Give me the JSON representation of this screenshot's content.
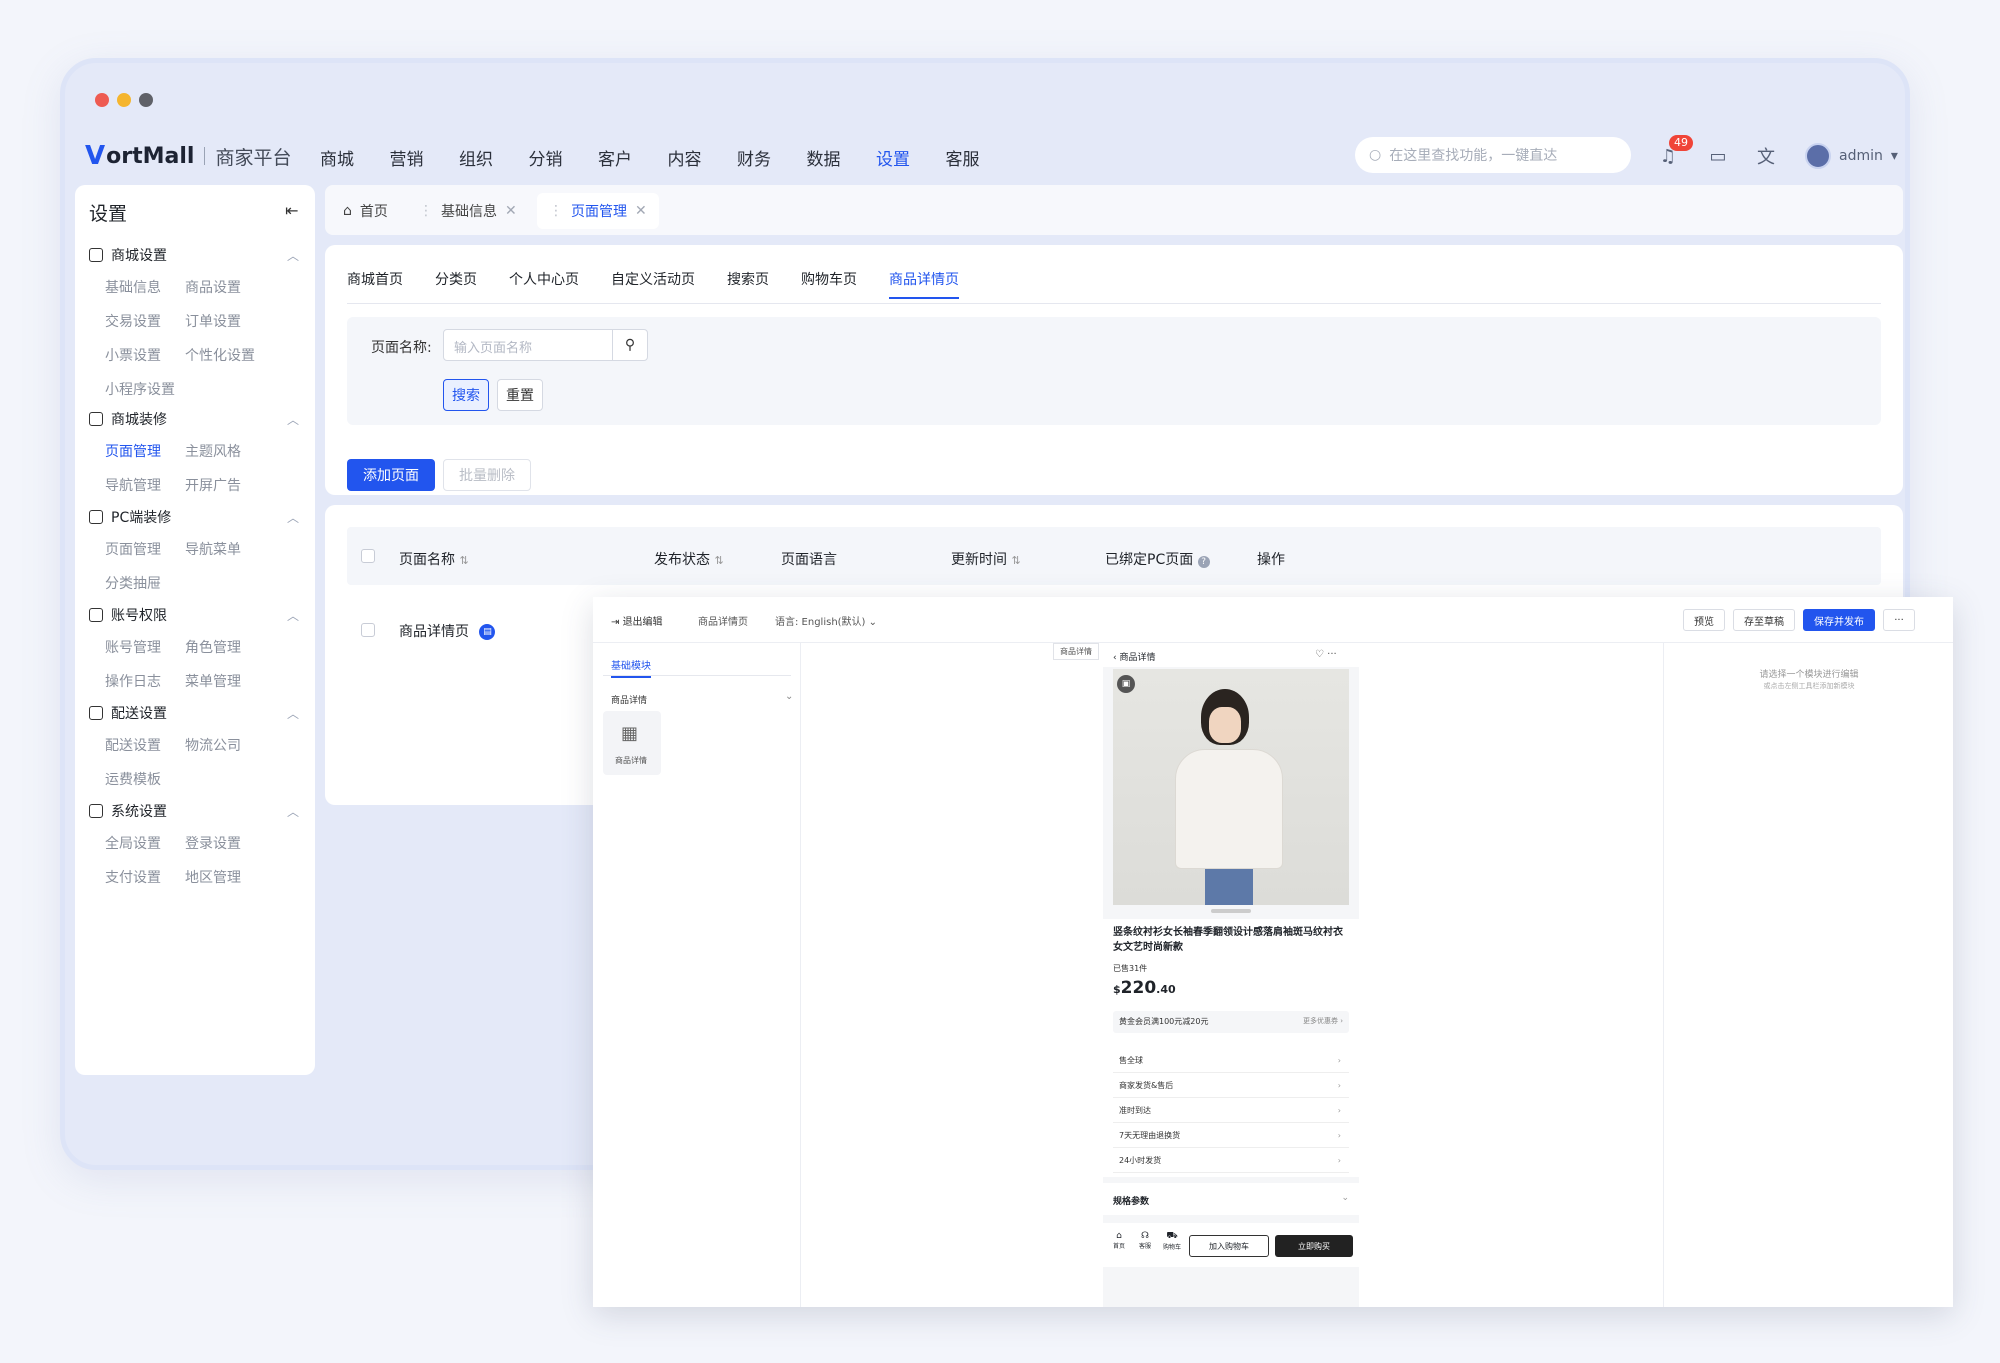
{
  "brand": {
    "logo_mark": "V",
    "logo_text": "ortMall",
    "subtitle": "商家平台"
  },
  "nav": [
    "商城",
    "营销",
    "组织",
    "分销",
    "客户",
    "内容",
    "财务",
    "数据",
    "设置",
    "客服"
  ],
  "nav_active": "设置",
  "search": {
    "placeholder": "在这里查找功能，一键直达"
  },
  "notifications": {
    "count": "49"
  },
  "user": {
    "name": "admin"
  },
  "sidebar": {
    "title": "设置",
    "groups": [
      {
        "label": "商城设置",
        "items": [
          "基础信息",
          "商品设置",
          "交易设置",
          "订单设置",
          "小票设置",
          "个性化设置",
          "小程序设置"
        ]
      },
      {
        "label": "商城装修",
        "items": [
          "页面管理",
          "主题风格",
          "导航管理",
          "开屏广告"
        ]
      },
      {
        "label": "PC端装修",
        "items": [
          "页面管理",
          "导航菜单",
          "分类抽屉"
        ]
      },
      {
        "label": "账号权限",
        "items": [
          "账号管理",
          "角色管理",
          "操作日志",
          "菜单管理"
        ]
      },
      {
        "label": "配送设置",
        "items": [
          "配送设置",
          "物流公司",
          "运费模板"
        ]
      },
      {
        "label": "系统设置",
        "items": [
          "全局设置",
          "登录设置",
          "支付设置",
          "地区管理"
        ]
      }
    ]
  },
  "page_tabs": [
    "首页",
    "基础信息",
    "页面管理"
  ],
  "content_tabs": [
    "商城首页",
    "分类页",
    "个人中心页",
    "自定义活动页",
    "搜索页",
    "购物车页",
    "商品详情页"
  ],
  "filter": {
    "label": "页面名称:",
    "placeholder": "输入页面名称",
    "search": "搜索",
    "reset": "重置"
  },
  "actions": {
    "add": "添加页面",
    "batch_delete": "批量删除"
  },
  "table": {
    "headers": [
      "页面名称",
      "发布状态",
      "页面语言",
      "更新时间",
      "已绑定PC页面",
      "操作"
    ],
    "rows": [
      {
        "name": "商品详情页"
      }
    ]
  },
  "editor": {
    "exit": "退出编辑",
    "page": "商品详情页",
    "lang": "语言: English(默认)",
    "preview": "预览",
    "save_draft": "存至草稿",
    "save_publish": "保存并发布",
    "more": "···",
    "left_tab": "基础模块",
    "section": "商品详情",
    "module": "商品详情",
    "canvas_tag": "商品详情",
    "right_hint1": "请选择一个模块进行编辑",
    "right_hint2": "或点击左侧工具栏添加新模块",
    "product": {
      "header": "商品详情",
      "title": "竖条纹衬衫女长袖春季翻领设计感落肩袖斑马纹衬衣女文艺时尚新款",
      "sold": "已售31件",
      "price_sym": "$",
      "price_int": "220",
      "price_dec": ".40",
      "coupon": "黄金会员满100元减20元",
      "coupon_more": "更多优惠券",
      "services": [
        "售全球",
        "商家发货&售后",
        "准时到达",
        "7天无理由退换货",
        "24小时发货"
      ],
      "specs": "规格参数",
      "bottom": {
        "home": "首页",
        "service": "客服",
        "cart": "购物车",
        "add_cart": "加入购物车",
        "buy": "立即购买"
      }
    }
  },
  "colors": {
    "accent": "#2255ee",
    "danger": "#f04438"
  }
}
